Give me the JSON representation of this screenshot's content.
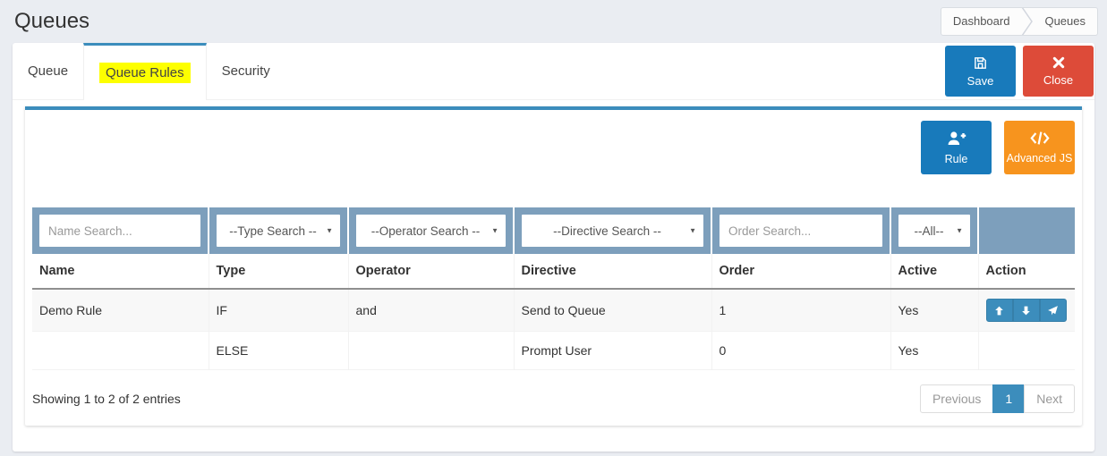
{
  "page": {
    "title": "Queues"
  },
  "breadcrumb": {
    "items": [
      {
        "label": "Dashboard"
      },
      {
        "label": "Queues"
      }
    ]
  },
  "tabs": {
    "queue": "Queue",
    "queue_rules": "Queue Rules",
    "security": "Security",
    "active_tab": "Queue Rules"
  },
  "header_buttons": {
    "save": "Save",
    "close": "Close"
  },
  "toolbar": {
    "rule": "Rule",
    "advanced_js": "Advanced JS"
  },
  "filters": {
    "name_placeholder": "Name Search...",
    "type_selected": "--Type Search --",
    "operator_selected": "--Operator Search --",
    "directive_selected": "--Directive Search --",
    "order_placeholder": "Order Search...",
    "active_selected": "--All--"
  },
  "table": {
    "columns": [
      "Name",
      "Type",
      "Operator",
      "Directive",
      "Order",
      "Active",
      "Action"
    ],
    "rows": [
      {
        "name": "Demo Rule",
        "type": "IF",
        "operator": "and",
        "directive": "Send to Queue",
        "order": "1",
        "active": "Yes"
      },
      {
        "name": "",
        "type": "ELSE",
        "operator": "",
        "directive": "Prompt User",
        "order": "0",
        "active": "Yes"
      }
    ]
  },
  "footer": {
    "info": "Showing 1 to 2 of 2 entries",
    "pagination": {
      "previous": "Previous",
      "current": "1",
      "next": "Next"
    }
  },
  "icons": {
    "save": "floppy-disk-icon",
    "close": "x-cross-icon",
    "rule": "user-plus-icon",
    "advanced_js": "code-brackets-icon",
    "breadcrumb_separator": "chevron-right-icon",
    "select_caret": "caret-down-icon",
    "row_actions": [
      "arrow-up-icon",
      "arrow-down-icon",
      "paper-plane-icon"
    ]
  },
  "colors": {
    "primary_blue": "#187abb",
    "light_blue": "#3c8dbc",
    "danger_red": "#dd4b39",
    "warning_orange": "#f7941e",
    "filter_row_bg": "#7d9fbc",
    "highlight_yellow": "#fdff00",
    "page_bg": "#eaedf2"
  }
}
